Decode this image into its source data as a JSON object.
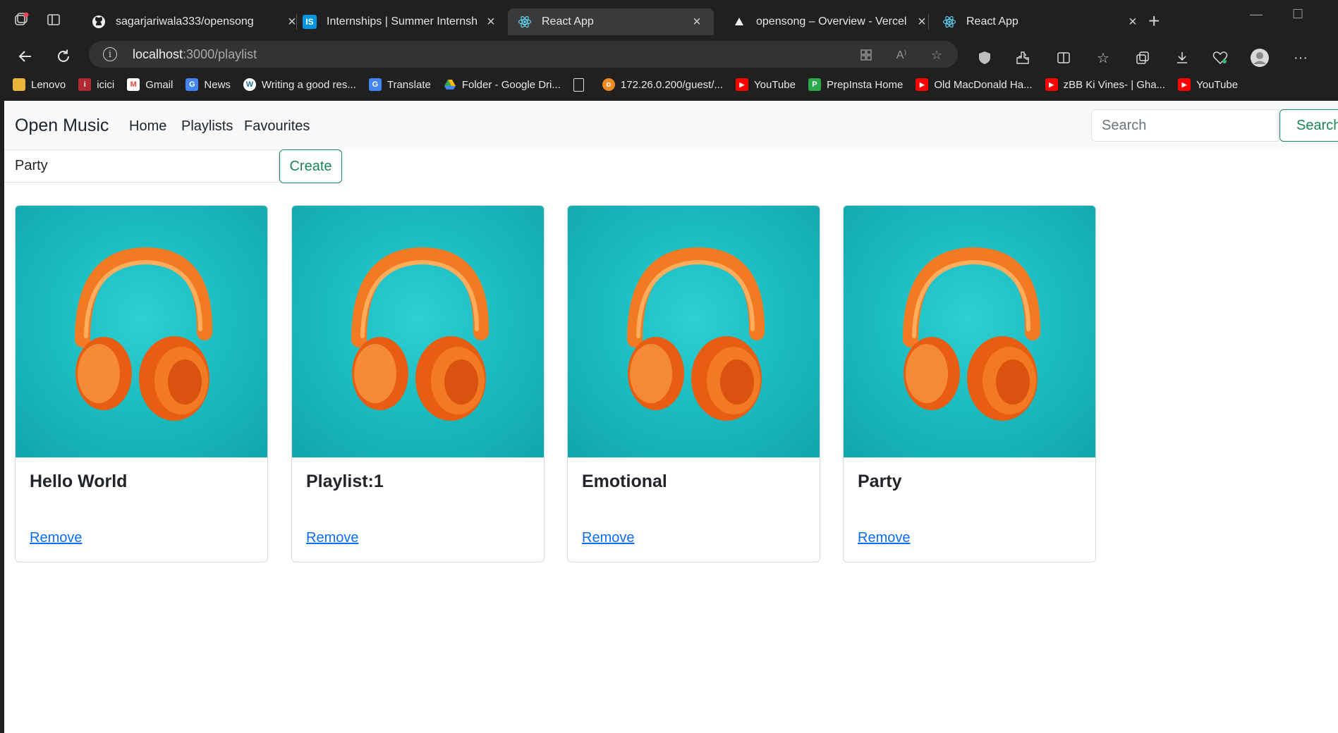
{
  "browser": {
    "tabs": [
      {
        "title": "sagarjariwala333/opensong",
        "icon": "github-icon"
      },
      {
        "title": "Internships | Summer Internship",
        "icon": "internshala-icon"
      },
      {
        "title": "React App",
        "icon": "react-icon",
        "active": true
      },
      {
        "title": "opensong – Overview - Vercel",
        "icon": "vercel-icon"
      },
      {
        "title": "React App",
        "icon": "react-icon"
      }
    ],
    "address": {
      "host": "localhost",
      "path": ":3000/playlist"
    },
    "bookmarks": [
      {
        "label": "Lenovo",
        "icon": "folder-icon"
      },
      {
        "label": "icici",
        "icon": "icici-icon"
      },
      {
        "label": "Gmail",
        "icon": "gmail-icon"
      },
      {
        "label": "News",
        "icon": "news-icon"
      },
      {
        "label": "Writing a good res...",
        "icon": "wordpress-icon"
      },
      {
        "label": "Translate",
        "icon": "translate-icon"
      },
      {
        "label": "Folder - Google Dri...",
        "icon": "google-drive-icon"
      },
      {
        "label": "",
        "icon": "page-icon"
      },
      {
        "label": "172.26.0.200/guest/...",
        "icon": "site-icon"
      },
      {
        "label": "YouTube",
        "icon": "youtube-icon"
      },
      {
        "label": "PrepInsta Home",
        "icon": "prepinsta-icon"
      },
      {
        "label": "Old MacDonald Ha...",
        "icon": "youtube-icon"
      },
      {
        "label": "zBB Ki Vines- | Gha...",
        "icon": "youtube-icon"
      },
      {
        "label": "YouTube",
        "icon": "youtube-icon"
      }
    ]
  },
  "app": {
    "brand": "Open Music",
    "nav": {
      "home": "Home",
      "playlists": "Playlists",
      "favourites": "Favourites"
    },
    "search": {
      "placeholder": "Search",
      "button": "Search"
    },
    "create": {
      "value": "Party",
      "button": "Create"
    },
    "playlists": [
      {
        "title": "Hello World",
        "remove": "Remove"
      },
      {
        "title": "Playlist:1",
        "remove": "Remove"
      },
      {
        "title": "Emotional",
        "remove": "Remove"
      },
      {
        "title": "Party",
        "remove": "Remove"
      }
    ],
    "colors": {
      "accent_green": "#198754",
      "link_blue": "#0d6efd",
      "card_bg_teal": "#1bbdc2",
      "headphone_orange": "#f26a1b"
    }
  }
}
